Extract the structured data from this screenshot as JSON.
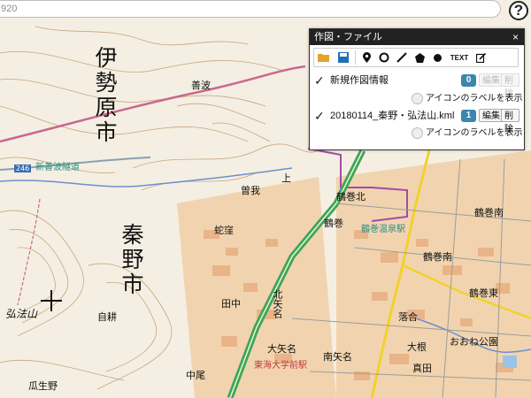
{
  "search": {
    "value": "920"
  },
  "help": {
    "label": "?"
  },
  "panel": {
    "title": "作図・ファイル",
    "close": "×",
    "toolbar": {
      "text_tool": "TEXT"
    },
    "rows": [
      {
        "label": "新規作図情報",
        "count": "0",
        "edit": "編集",
        "delete": "削除",
        "edit_enabled": false,
        "radio_label": "アイコンのラベルを表示"
      },
      {
        "label": "20180114_秦野・弘法山.kml",
        "count": "1",
        "edit": "編集",
        "delete": "削除",
        "edit_enabled": true,
        "radio_label": "アイコンのラベルを表示"
      }
    ]
  },
  "map": {
    "city_isehara": "伊勢原市",
    "city_hadano": "秦野市",
    "mountain": "弘法山",
    "labels": {
      "zenpa": "善波",
      "zenpa_tunnel": "新善波隧道",
      "route_246": "246",
      "uwa": "上",
      "sonogaya": "曽我",
      "hebizuka": "蛇窪",
      "tsurumaki": "鶴巻",
      "tsurumaki_onsen": "鶴巻温泉駅",
      "tsurumaki_kita": "鶴巻北",
      "tsurumaki_minami1": "鶴巻南",
      "tsurumaki_minami2": "鶴巻南",
      "tsurumaki_higashi": "鶴巻東",
      "ochiai": "落合",
      "tanaka": "田中",
      "kitano": "北矢名",
      "oyane": "大矢名",
      "tokai_station": "東海大学前駅",
      "minami_yana": "南矢名",
      "jiban": "自耕",
      "nakao": "中尾",
      "kuriko": "瓜生野",
      "oone_park": "おおね公園",
      "oone": "大根",
      "makuta": "真田"
    }
  },
  "colors": {
    "contour": "#c9a57e",
    "road_pink": "#c9688f",
    "rail_green": "#3fa556",
    "road_yellow": "#f2d12c",
    "river": "#6a8fcf",
    "teal": "#2a8f83",
    "badge": "#3a87ad"
  }
}
